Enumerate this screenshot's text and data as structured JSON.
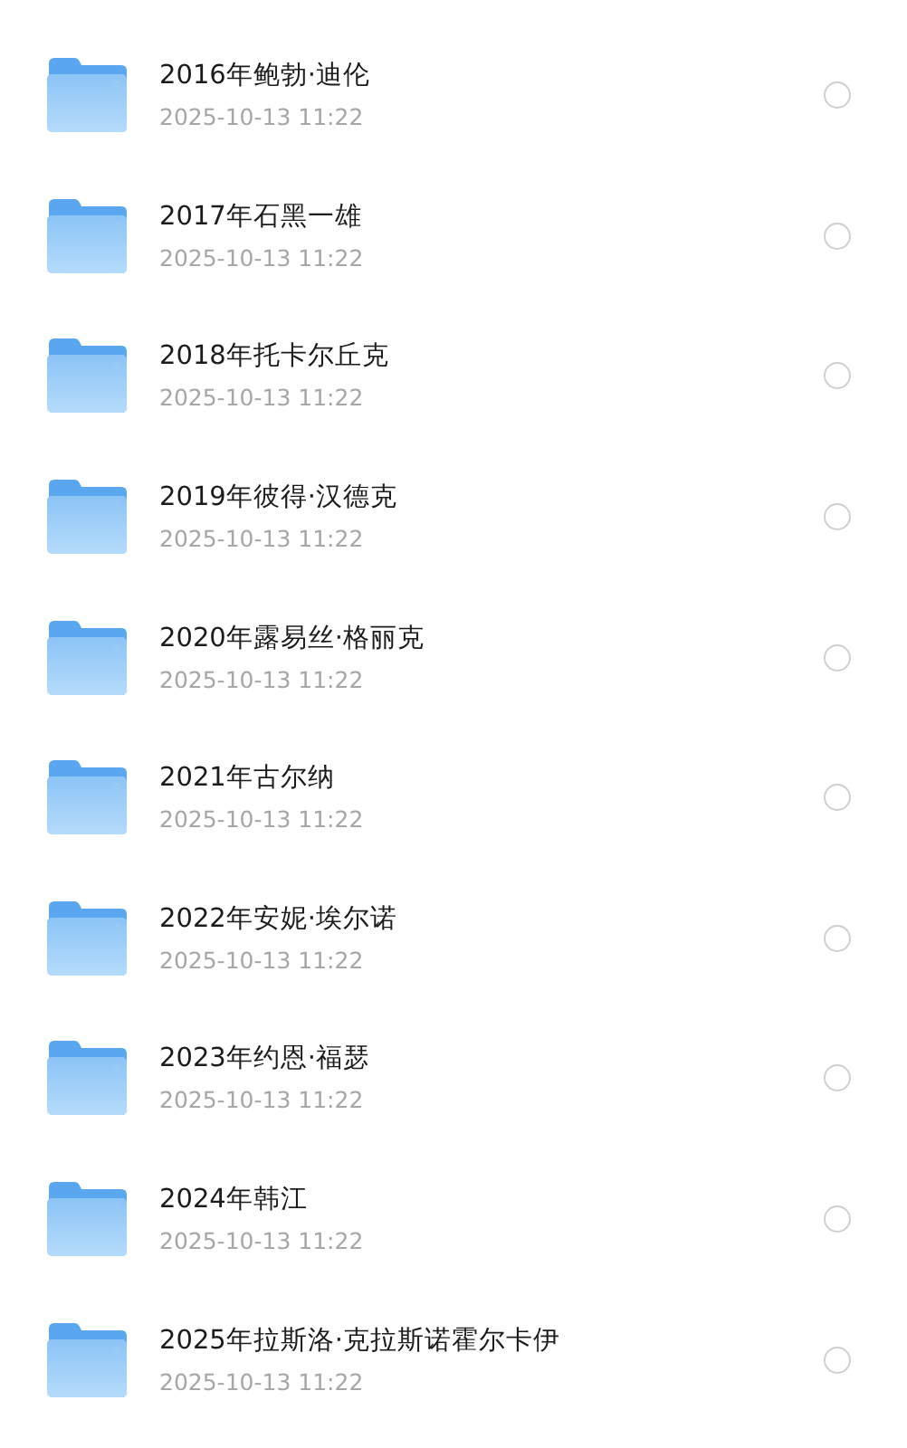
{
  "files": [
    {
      "name": "2016年鲍勃·迪伦",
      "modified": "2025-10-13 11:22",
      "selected": false
    },
    {
      "name": "2017年石黑一雄",
      "modified": "2025-10-13 11:22",
      "selected": false
    },
    {
      "name": "2018年托卡尔丘克",
      "modified": "2025-10-13 11:22",
      "selected": false
    },
    {
      "name": "2019年彼得·汉德克",
      "modified": "2025-10-13 11:22",
      "selected": false
    },
    {
      "name": "2020年露易丝·格丽克",
      "modified": "2025-10-13 11:22",
      "selected": false
    },
    {
      "name": "2021年古尔纳",
      "modified": "2025-10-13 11:22",
      "selected": false
    },
    {
      "name": "2022年安妮·埃尔诺",
      "modified": "2025-10-13 11:22",
      "selected": false
    },
    {
      "name": "2023年约恩·福瑟",
      "modified": "2025-10-13 11:22",
      "selected": false
    },
    {
      "name": "2024年韩江",
      "modified": "2025-10-13 11:22",
      "selected": false
    },
    {
      "name": "2025年拉斯洛·克拉斯诺霍尔卡伊",
      "modified": "2025-10-13 11:22",
      "selected": false
    }
  ]
}
